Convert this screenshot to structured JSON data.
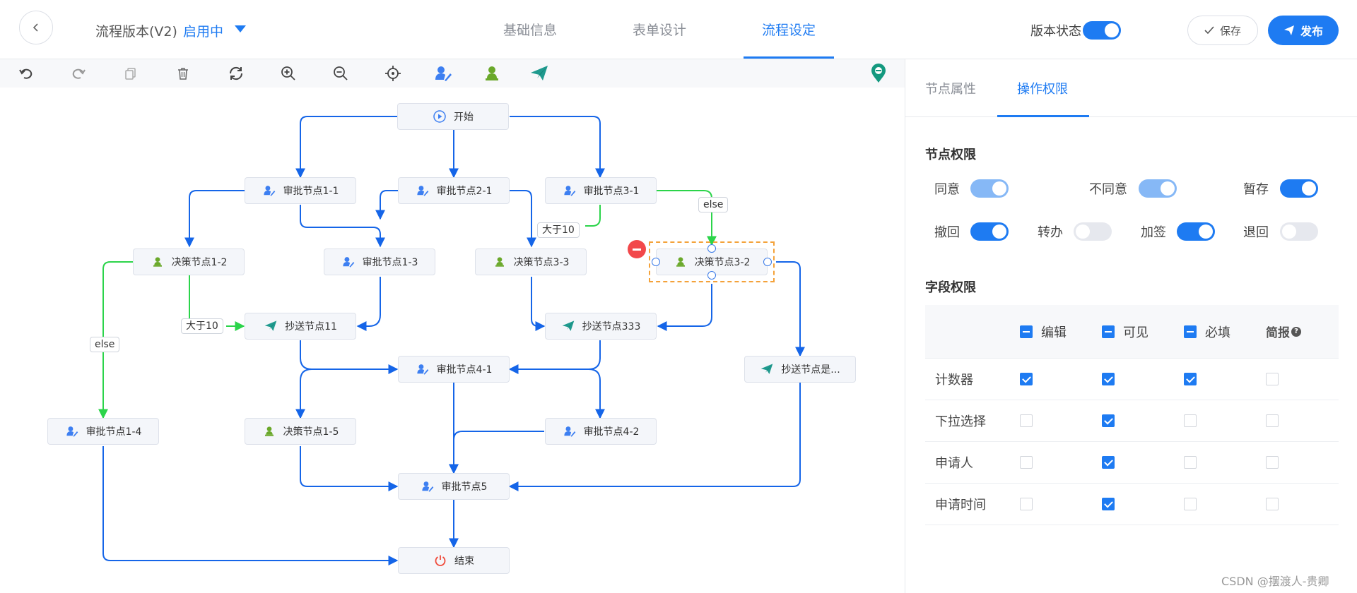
{
  "header": {
    "version_title": "流程版本(V2)",
    "version_status": "启用中",
    "tabs": [
      "基础信息",
      "表单设计",
      "流程设定"
    ],
    "active_tab": "流程设定",
    "version_state_label": "版本状态",
    "version_state_on": true,
    "save_label": "保存",
    "publish_label": "发布"
  },
  "toolbar": {
    "tools": [
      "undo-icon",
      "redo-icon",
      "copy-icon",
      "trash-icon",
      "refresh-icon",
      "zoom-in-icon",
      "zoom-out-icon",
      "locate-icon",
      "approver-node-icon",
      "decision-node-icon",
      "cc-node-icon",
      "map-pin-icon"
    ]
  },
  "flow": {
    "nodes": {
      "start": "开始",
      "a11": "审批节点1-1",
      "a21": "审批节点2-1",
      "a31": "审批节点3-1",
      "d12": "决策节点1-2",
      "a13": "审批节点1-3",
      "d33": "决策节点3-3",
      "d32": "决策节点3-2",
      "c11": "抄送节点11",
      "c333": "抄送节点333",
      "a41": "审批节点4-1",
      "cshi": "抄送节点是...",
      "a14": "审批节点1-4",
      "d15": "决策节点1-5",
      "a42": "审批节点4-2",
      "a5": "审批节点5",
      "end": "结束"
    },
    "edge_labels": {
      "else_top": "else",
      "gt10_mid": "大于10",
      "gt10_left": "大于10",
      "else_left": "else"
    },
    "colors": {
      "edge_blue": "#1565e8",
      "edge_green": "#2bd44a",
      "approver": "#3d7ff1",
      "decision": "#6aa82a",
      "cc": "#1f9a8e",
      "start": "#3d7ff1",
      "end": "#f04a3a",
      "selection": "#f4a23a"
    }
  },
  "panel": {
    "tabs": [
      "节点属性",
      "操作权限"
    ],
    "active_tab": "操作权限",
    "node_perm_title": "节点权限",
    "node_perms": [
      {
        "label": "同意",
        "on": true,
        "light": true
      },
      {
        "label": "不同意",
        "on": true,
        "light": true
      },
      {
        "label": "暂存",
        "on": true,
        "light": false
      },
      {
        "label": "撤回",
        "on": true,
        "light": false
      },
      {
        "label": "转办",
        "on": false,
        "light": false
      },
      {
        "label": "加签",
        "on": true,
        "light": false
      },
      {
        "label": "退回",
        "on": false,
        "light": false
      }
    ],
    "field_perm_title": "字段权限",
    "field_columns": [
      "编辑",
      "可见",
      "必填",
      "简报"
    ],
    "field_rows": [
      {
        "name": "计数器",
        "edit": true,
        "visible": true,
        "required": true,
        "brief": false
      },
      {
        "name": "下拉选择",
        "edit": false,
        "visible": true,
        "required": false,
        "brief": false
      },
      {
        "name": "申请人",
        "edit": false,
        "visible": true,
        "required": false,
        "brief": false
      },
      {
        "name": "申请时间",
        "edit": false,
        "visible": true,
        "required": false,
        "brief": false
      }
    ]
  },
  "watermark": "CSDN @摆渡人-贵卿"
}
